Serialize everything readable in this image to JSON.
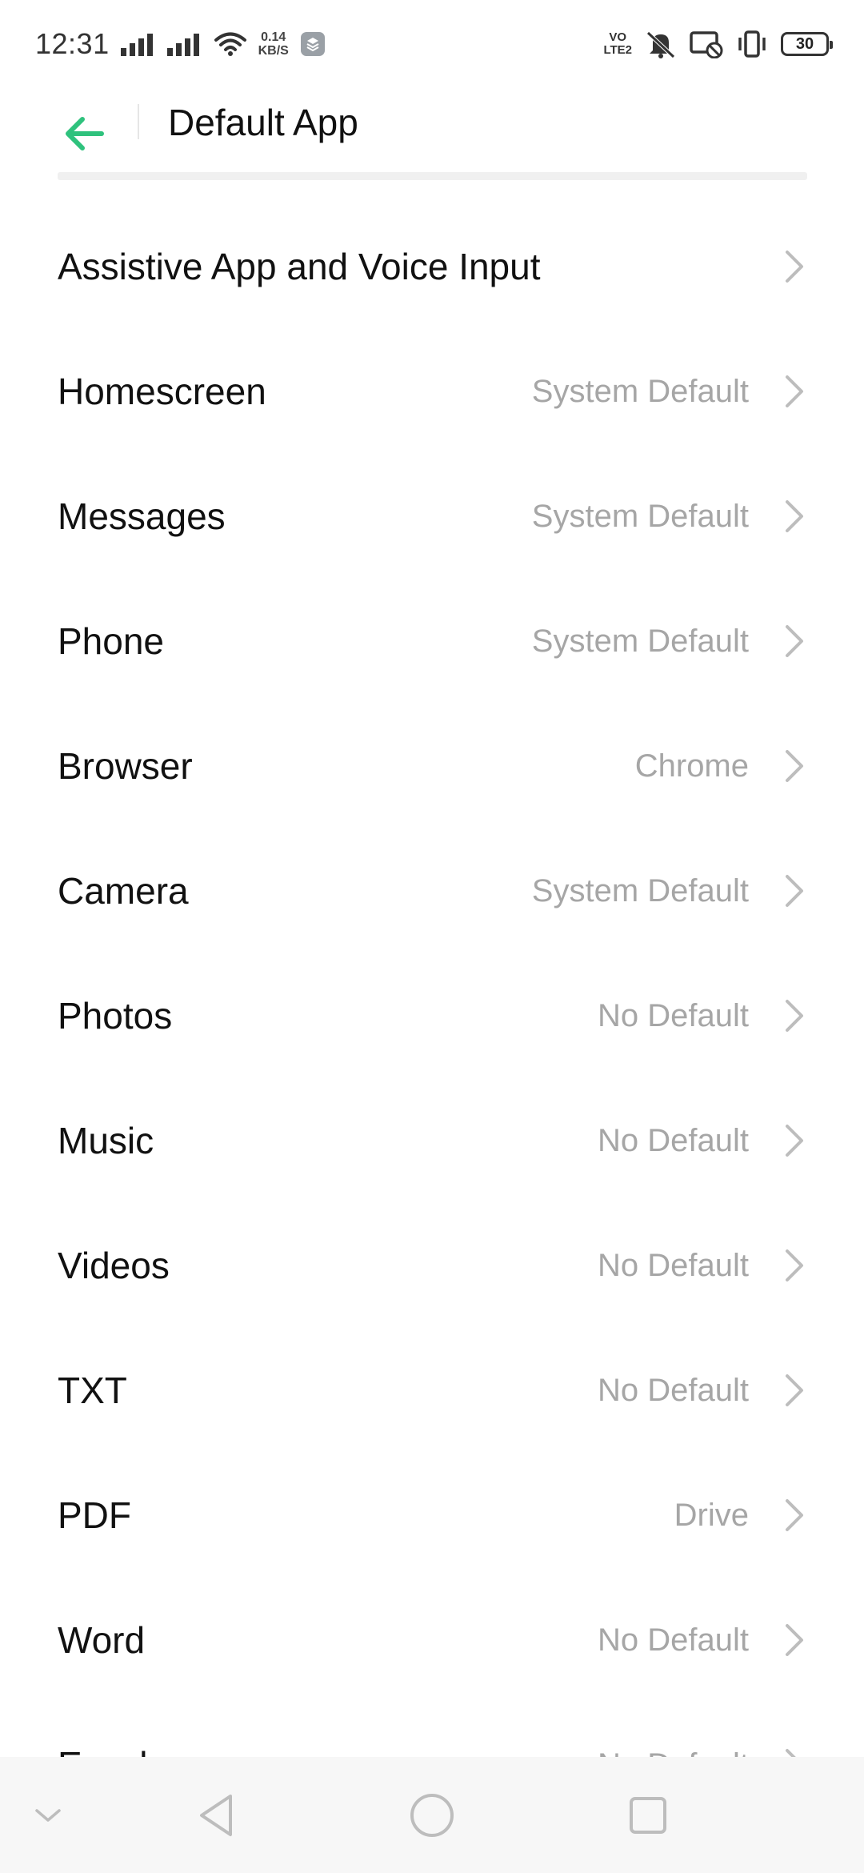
{
  "status_bar": {
    "time": "12:31",
    "net_speed_value": "0.14",
    "net_speed_unit": "KB/S",
    "volte_top": "VO",
    "volte_bottom": "LTE2",
    "battery_level": "30",
    "icons": [
      "signal-icon",
      "signal-icon",
      "wifi-icon",
      "app-notification-icon",
      "volte-icon",
      "mute-icon",
      "cast-blocked-icon",
      "vibrate-icon",
      "battery-icon"
    ]
  },
  "header": {
    "title": "Default App",
    "back_icon": "back-arrow-icon",
    "accent_color": "#2fc27d"
  },
  "items": [
    {
      "label": "Assistive App and Voice Input",
      "value": ""
    },
    {
      "label": "Homescreen",
      "value": "System Default"
    },
    {
      "label": "Messages",
      "value": "System Default"
    },
    {
      "label": "Phone",
      "value": "System Default"
    },
    {
      "label": "Browser",
      "value": "Chrome"
    },
    {
      "label": "Camera",
      "value": "System Default"
    },
    {
      "label": "Photos",
      "value": "No Default"
    },
    {
      "label": "Music",
      "value": "No Default"
    },
    {
      "label": "Videos",
      "value": "No Default"
    },
    {
      "label": "TXT",
      "value": "No Default"
    },
    {
      "label": "PDF",
      "value": "Drive"
    },
    {
      "label": "Word",
      "value": "No Default"
    },
    {
      "label": "Excel",
      "value": "No Default"
    }
  ],
  "nav_bar": {
    "buttons": [
      "collapse-icon",
      "back-icon",
      "home-icon",
      "recents-icon"
    ]
  }
}
